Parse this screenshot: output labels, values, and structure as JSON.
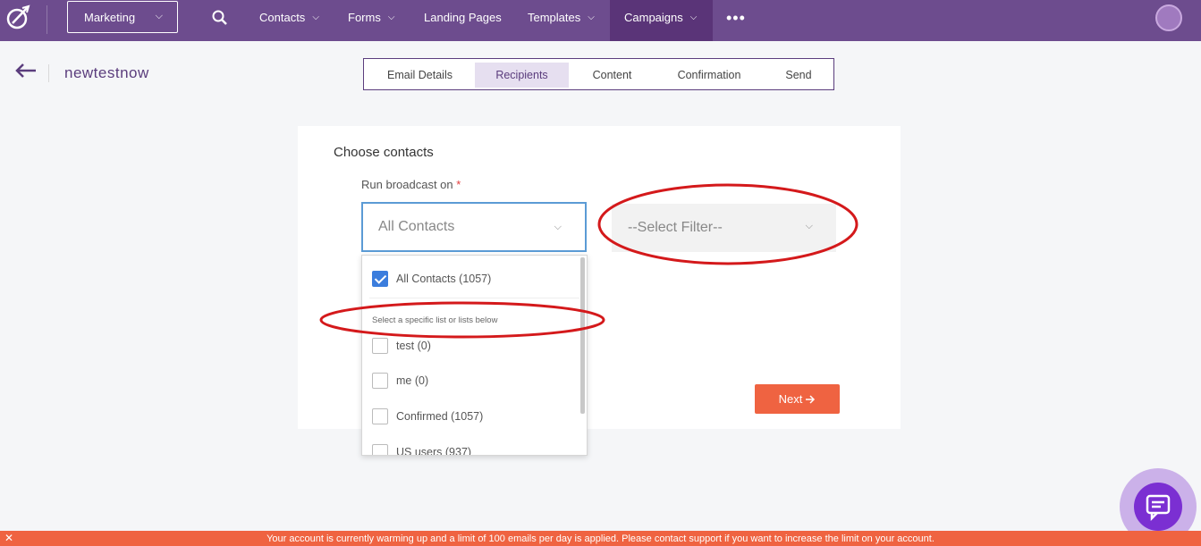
{
  "nav": {
    "workspace": "Marketing",
    "items": [
      {
        "label": "Contacts",
        "has_dropdown": true
      },
      {
        "label": "Forms",
        "has_dropdown": true
      },
      {
        "label": "Landing Pages",
        "has_dropdown": false
      },
      {
        "label": "Templates",
        "has_dropdown": true
      },
      {
        "label": "Campaigns",
        "has_dropdown": true,
        "active": true
      }
    ],
    "more": "•••"
  },
  "header": {
    "campaign_name": "newtestnow",
    "steps": [
      "Email Details",
      "Recipients",
      "Content",
      "Confirmation",
      "Send"
    ],
    "active_step": "Recipients"
  },
  "form": {
    "title": "Choose contacts",
    "label": "Run broadcast on",
    "required_mark": "*",
    "contacts_value": "All Contacts",
    "filter_placeholder": "--Select Filter--",
    "next_label": "Next"
  },
  "dropdown": {
    "all_option": "All Contacts (1057)",
    "all_checked": true,
    "note": "Select a specific list or lists below",
    "lists": [
      "test (0)",
      "me (0)",
      "Confirmed (1057)",
      "US users (937)"
    ]
  },
  "banner": {
    "close": "✕",
    "message": "Your account is currently warming up and a limit of 100 emails per day is applied. Please contact support if you want to increase the limit on your account."
  },
  "colors": {
    "nav_bg": "#6d4c8e",
    "nav_active": "#5a3478",
    "accent": "#ef6341",
    "focus": "#5b9bd5",
    "checkbox": "#3b7ddd",
    "annotation": "#d4191b"
  }
}
